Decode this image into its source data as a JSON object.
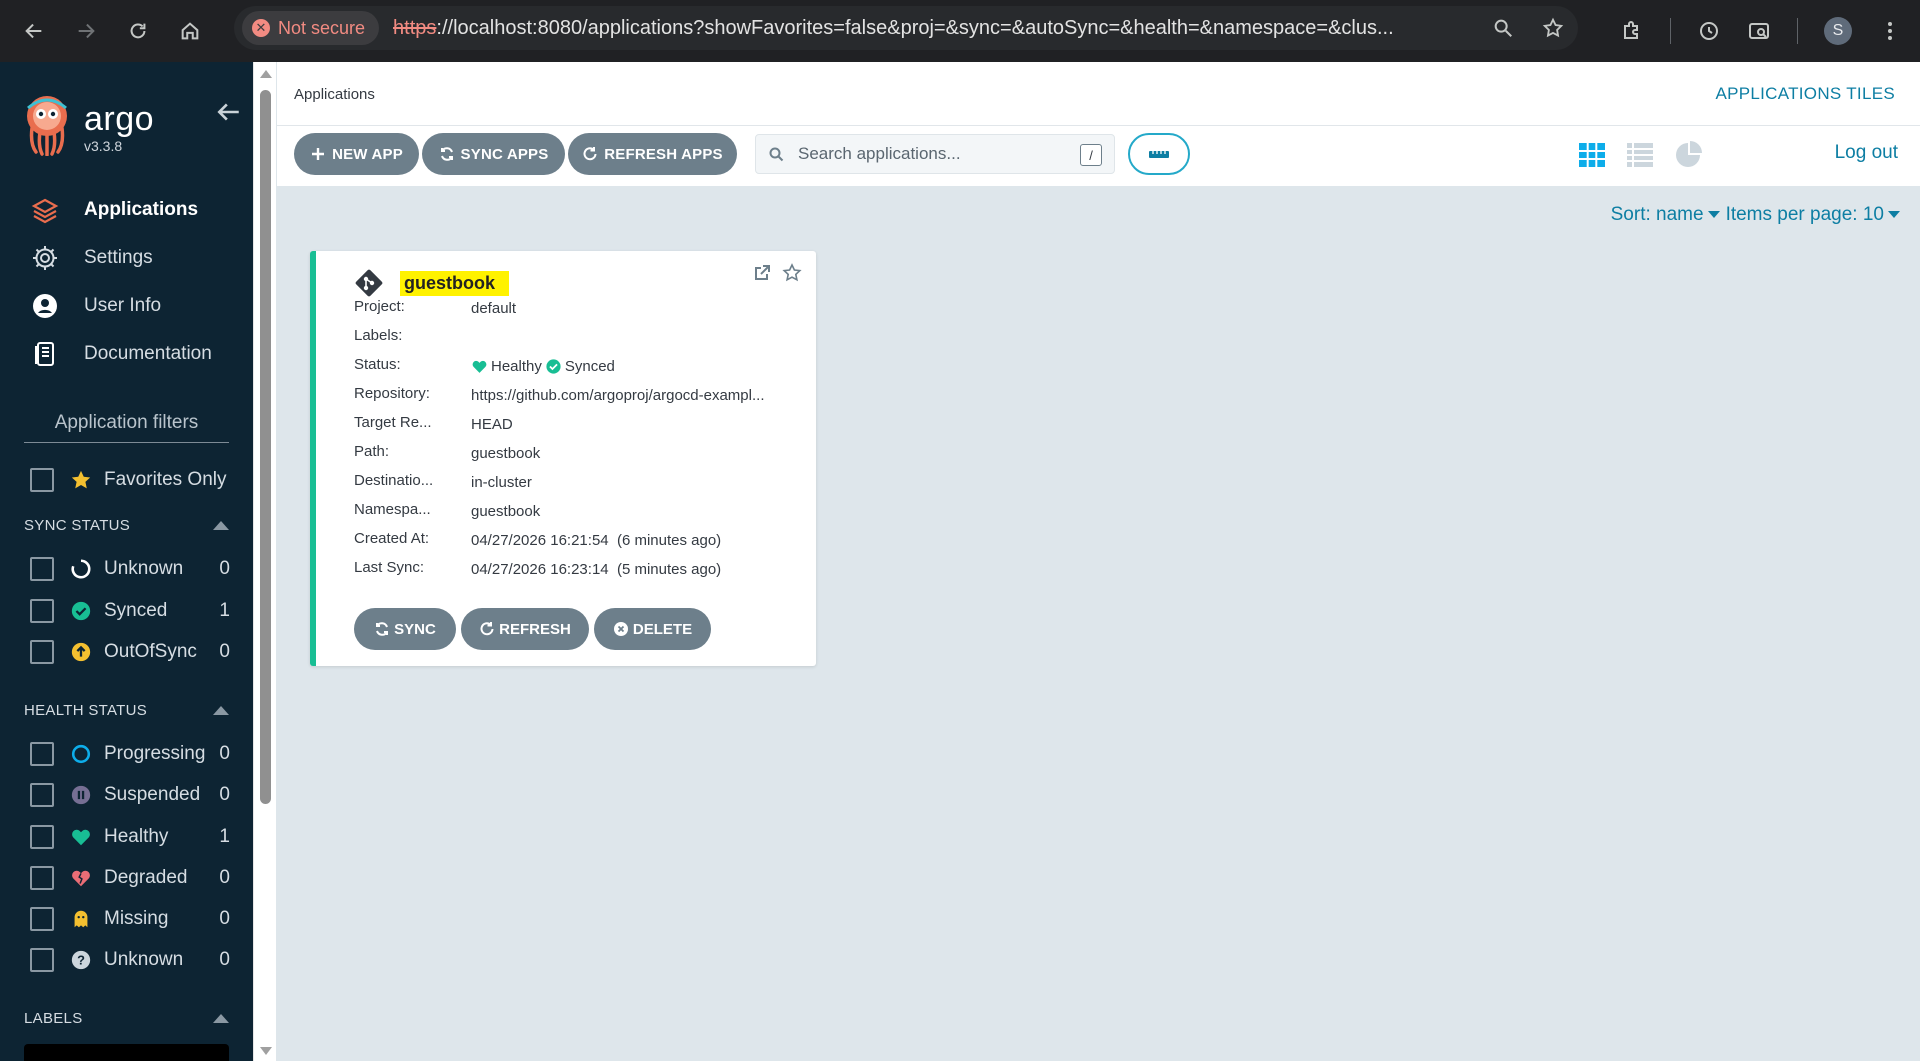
{
  "browser": {
    "security_label": "Not secure",
    "url_scheme": "https",
    "url_rest": "://localhost:8080/applications?showFavorites=false&proj=&sync=&autoSync=&health=&namespace=&clus...",
    "profile_initial": "S"
  },
  "sidebar": {
    "brand": "argo",
    "version": "v3.3.8",
    "nav": [
      {
        "label": "Applications",
        "icon": "layers-icon",
        "active": true
      },
      {
        "label": "Settings",
        "icon": "gear-icon"
      },
      {
        "label": "User Info",
        "icon": "user-icon"
      },
      {
        "label": "Documentation",
        "icon": "book-icon"
      }
    ],
    "filters_title": "Application filters",
    "favorites_label": "Favorites Only",
    "sync_status": {
      "title": "SYNC STATUS",
      "items": [
        {
          "label": "Unknown",
          "count": "0",
          "color": "#ffffff"
        },
        {
          "label": "Synced",
          "count": "1",
          "color": "#18be94"
        },
        {
          "label": "OutOfSync",
          "count": "0",
          "color": "#f4c030"
        }
      ]
    },
    "health_status": {
      "title": "HEALTH STATUS",
      "items": [
        {
          "label": "Progressing",
          "count": "0",
          "color": "#0dadea"
        },
        {
          "label": "Suspended",
          "count": "0",
          "color": "#766f94"
        },
        {
          "label": "Healthy",
          "count": "1",
          "color": "#18be94"
        },
        {
          "label": "Degraded",
          "count": "0",
          "color": "#e96d76"
        },
        {
          "label": "Missing",
          "count": "0",
          "color": "#f4c030"
        },
        {
          "label": "Unknown",
          "count": "0",
          "color": "#ccd6dd"
        }
      ]
    },
    "labels_title": "LABELS"
  },
  "header": {
    "breadcrumb": "Applications",
    "view_title": "APPLICATIONS TILES",
    "logout": "Log out"
  },
  "toolbar": {
    "new_app": "NEW APP",
    "sync_apps": "SYNC APPS",
    "refresh_apps": "REFRESH APPS",
    "search_placeholder": "Search applications...",
    "search_shortcut": "/"
  },
  "sort": {
    "sort_label": "Sort: name",
    "items_label": "Items per page: 10"
  },
  "app": {
    "name": "guestbook",
    "fields": [
      {
        "key": "Project:",
        "value": "default"
      },
      {
        "key": "Labels:",
        "value": ""
      },
      {
        "key": "Status:",
        "value": ""
      },
      {
        "key": "Repository:",
        "value": "https://github.com/argoproj/argocd-exampl..."
      },
      {
        "key": "Target Re...",
        "value": "HEAD"
      },
      {
        "key": "Path:",
        "value": "guestbook"
      },
      {
        "key": "Destinatio...",
        "value": "in-cluster"
      },
      {
        "key": "Namespa...",
        "value": "guestbook"
      },
      {
        "key": "Created At:",
        "value": "04/27/2026 16:21:54  (6 minutes ago)"
      },
      {
        "key": "Last Sync:",
        "value": "04/27/2026 16:23:14  (5 minutes ago)"
      }
    ],
    "health": "Healthy",
    "sync": "Synced",
    "buttons": {
      "sync": "SYNC",
      "refresh": "REFRESH",
      "delete": "DELETE"
    }
  },
  "colors": {
    "accent": "#0d7ea3",
    "sidebar_bg": "#0d2433",
    "healthy": "#18be94",
    "button": "#6d7f8b"
  }
}
